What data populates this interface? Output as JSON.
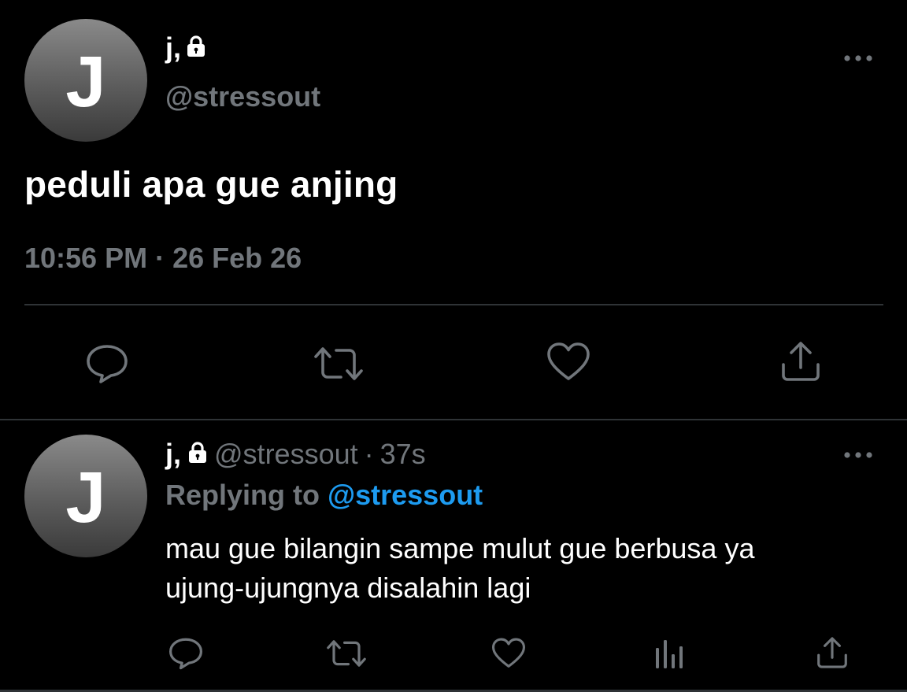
{
  "main_tweet": {
    "avatar_letter": "J",
    "display_name": "j,",
    "handle": "@stressout",
    "text": "peduli apa gue anjing",
    "time": "10:56 PM",
    "separator": "·",
    "date": "26 Feb 26",
    "actions": [
      "reply-icon",
      "retweet-icon",
      "like-icon",
      "share-icon"
    ]
  },
  "reply_tweet": {
    "avatar_letter": "J",
    "display_name": "j,",
    "handle": "@stressout",
    "separator": "·",
    "age": "37s",
    "replying_prefix": "Replying to",
    "replying_mention": "@stressout",
    "text_lines": [
      "mau gue bilangin sampe mulut gue berbusa ya",
      "ujung-ujungnya disalahin lagi"
    ],
    "actions": [
      "reply-icon",
      "retweet-icon",
      "like-icon",
      "analytics-icon",
      "share-icon"
    ]
  },
  "colors": {
    "background": "#000000",
    "primary_text": "#ffffff",
    "secondary_text": "#71767b",
    "accent": "#1d9bf0",
    "divider": "#2f3336"
  }
}
